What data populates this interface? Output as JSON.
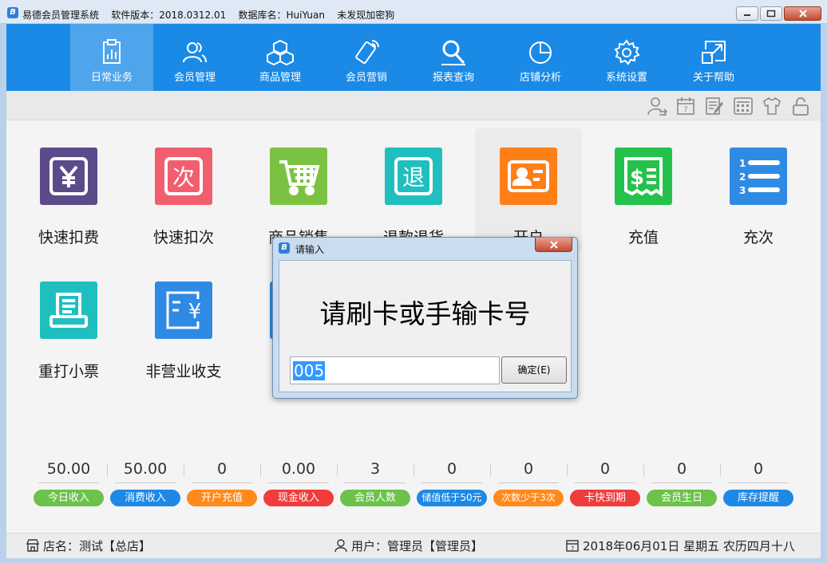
{
  "window": {
    "title": "易德会员管理系统    软件版本：2018.0312.01    数据库名：HuiYuan    未发现加密狗",
    "app_icon_letter": "B"
  },
  "nav": [
    {
      "label": "日常业务",
      "icon": "clipboard-icon",
      "active": true
    },
    {
      "label": "会员管理",
      "icon": "users-icon",
      "active": false
    },
    {
      "label": "商品管理",
      "icon": "boxes-icon",
      "active": false
    },
    {
      "label": "会员营销",
      "icon": "phone-icon",
      "active": false
    },
    {
      "label": "报表查询",
      "icon": "magnifier-icon",
      "active": false
    },
    {
      "label": "店铺分析",
      "icon": "pie-chart-icon",
      "active": false
    },
    {
      "label": "系统设置",
      "icon": "gear-icon",
      "active": false
    },
    {
      "label": "关于帮助",
      "icon": "help-icon",
      "active": false
    }
  ],
  "toolbar_icons": [
    "user-switch-icon",
    "calendar-icon",
    "notes-icon",
    "calculator-icon",
    "shirt-icon",
    "lock-icon"
  ],
  "tiles": {
    "row1": [
      {
        "label": "快速扣费",
        "glyph": "¥",
        "color": "#5b4b8a",
        "icon": "yen-card-icon"
      },
      {
        "label": "快速扣次",
        "glyph": "次",
        "color": "#f15f6e",
        "icon": "count-card-icon"
      },
      {
        "label": "商品销售",
        "glyph": "",
        "color": "#7cc242",
        "icon": "shopping-cart-icon"
      },
      {
        "label": "退款退货",
        "glyph": "退",
        "color": "#1fbfbf",
        "icon": "refund-icon"
      },
      {
        "label": "开户",
        "glyph": "",
        "color": "#ff7f17",
        "icon": "id-card-icon"
      },
      {
        "label": "充值",
        "glyph": "$",
        "color": "#24c24a",
        "icon": "recharge-icon"
      },
      {
        "label": "充次",
        "glyph": "",
        "color": "#2f8ae3",
        "icon": "numbered-list-icon"
      }
    ],
    "row2": [
      {
        "label": "重打小票",
        "glyph": "",
        "color": "#1fbfbf",
        "icon": "receipt-printer-icon"
      },
      {
        "label": "非营业收支",
        "glyph": "¥",
        "color": "#2f8ae3",
        "icon": "bill-yen-icon"
      }
    ]
  },
  "stats": [
    {
      "value": "50.00",
      "label": "今日收入",
      "color": "#6cc24a"
    },
    {
      "value": "50.00",
      "label": "消费收入",
      "color": "#1e88e5"
    },
    {
      "value": "0",
      "label": "开户充值",
      "color": "#ff8a1c"
    },
    {
      "value": "0.00",
      "label": "现金收入",
      "color": "#f03c3c"
    },
    {
      "value": "3",
      "label": "会员人数",
      "color": "#6cc24a"
    },
    {
      "value": "0",
      "label": "储值低于50元",
      "color": "#1e88e5"
    },
    {
      "value": "0",
      "label": "次数少于3次",
      "color": "#ff8a1c"
    },
    {
      "value": "0",
      "label": "卡快到期",
      "color": "#f03c3c"
    },
    {
      "value": "0",
      "label": "会员生日",
      "color": "#6cc24a"
    },
    {
      "value": "0",
      "label": "库存提醒",
      "color": "#1e88e5"
    }
  ],
  "status": {
    "shop": "店名：测试【总店】",
    "user": "用户：管理员【管理员】",
    "date": "2018年06月01日 星期五 农历四月十八"
  },
  "dialog": {
    "title": "请输入",
    "prompt": "请刷卡或手输卡号",
    "input_value": "005",
    "ok_label": "确定(E)"
  },
  "colors": {
    "nav_bg": "#1a8ae6",
    "nav_active": "#4ea5ec"
  }
}
